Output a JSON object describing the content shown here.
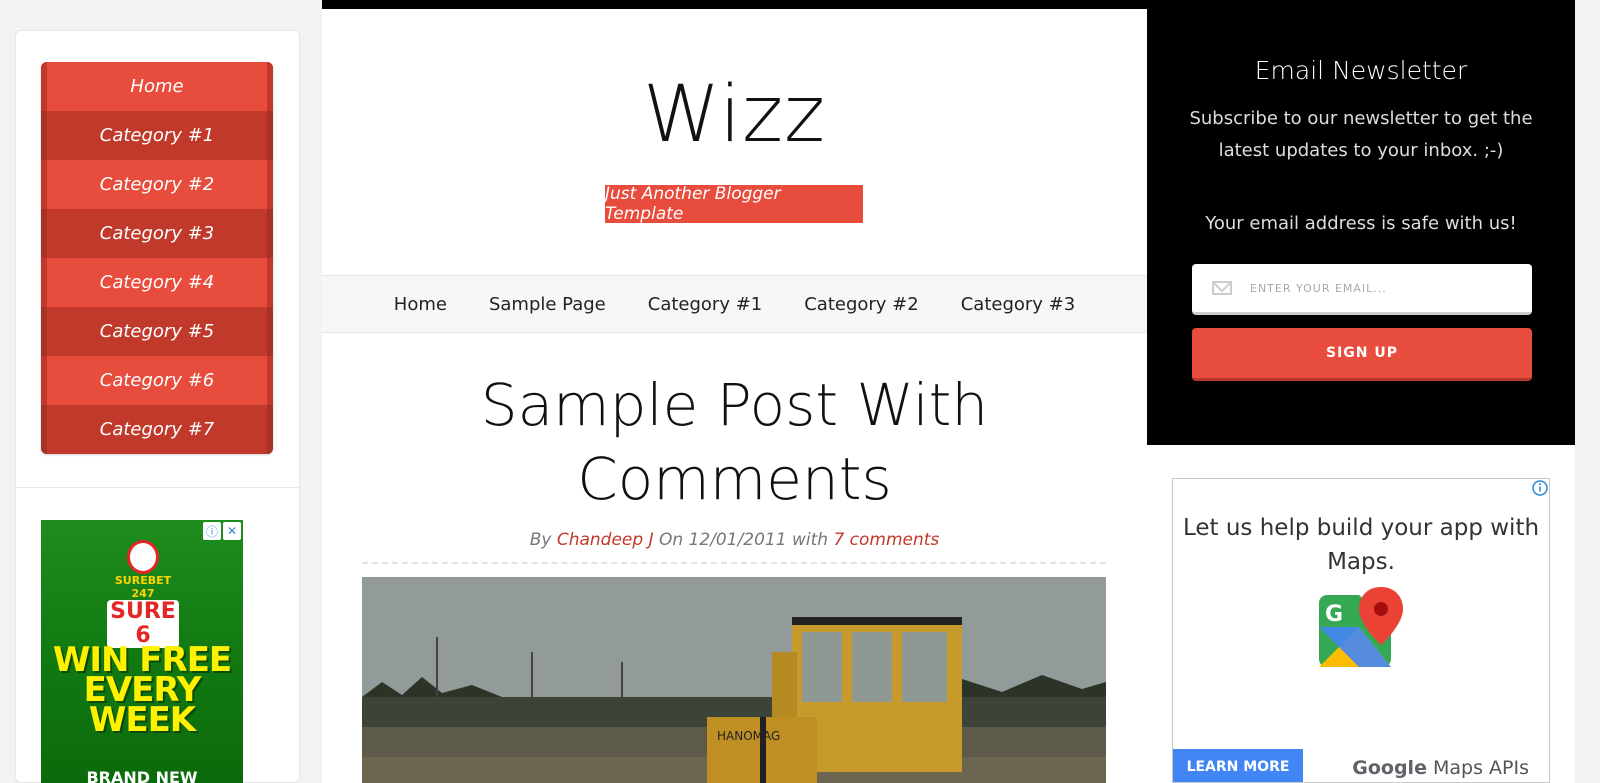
{
  "left_menu": {
    "items": [
      "Home",
      "Category #1",
      "Category #2",
      "Category #3",
      "Category #4",
      "Category #5",
      "Category #6",
      "Category #7"
    ]
  },
  "ad_left": {
    "brand_top": "SUREBET 247",
    "brand": "SURE 6",
    "headline": "WIN FREE EVERY WEEK",
    "sub": "BRAND NEW",
    "info_icon": "info-icon",
    "close_icon": "close-icon"
  },
  "header": {
    "title": "Wizz",
    "tagline": "Just Another Blogger Template"
  },
  "nav": {
    "links": [
      "Home",
      "Sample Page",
      "Category #1",
      "Category #2",
      "Category #3"
    ]
  },
  "post": {
    "title_line1": "Sample Post With",
    "title_line2": "Comments",
    "meta_by": "By",
    "author": "Chandeep J",
    "meta_on": "On 12/01/2011 with",
    "comments": "7 comments"
  },
  "newsletter": {
    "title": "Email Newsletter",
    "description": "Subscribe to our newsletter to get the latest updates to your inbox. ;-)",
    "safe_text": "Your email address is safe with us!",
    "placeholder": "ENTER YOUR EMAIL...",
    "button": "SIGN UP"
  },
  "ad_right": {
    "headline": "Let us help build your app with Maps.",
    "cta": "LEARN MORE",
    "footer_brand": "Google",
    "footer_product": "Maps APIs"
  },
  "colors": {
    "accent": "#e74c3c",
    "accent_dark": "#c0392b",
    "black": "#000000"
  }
}
